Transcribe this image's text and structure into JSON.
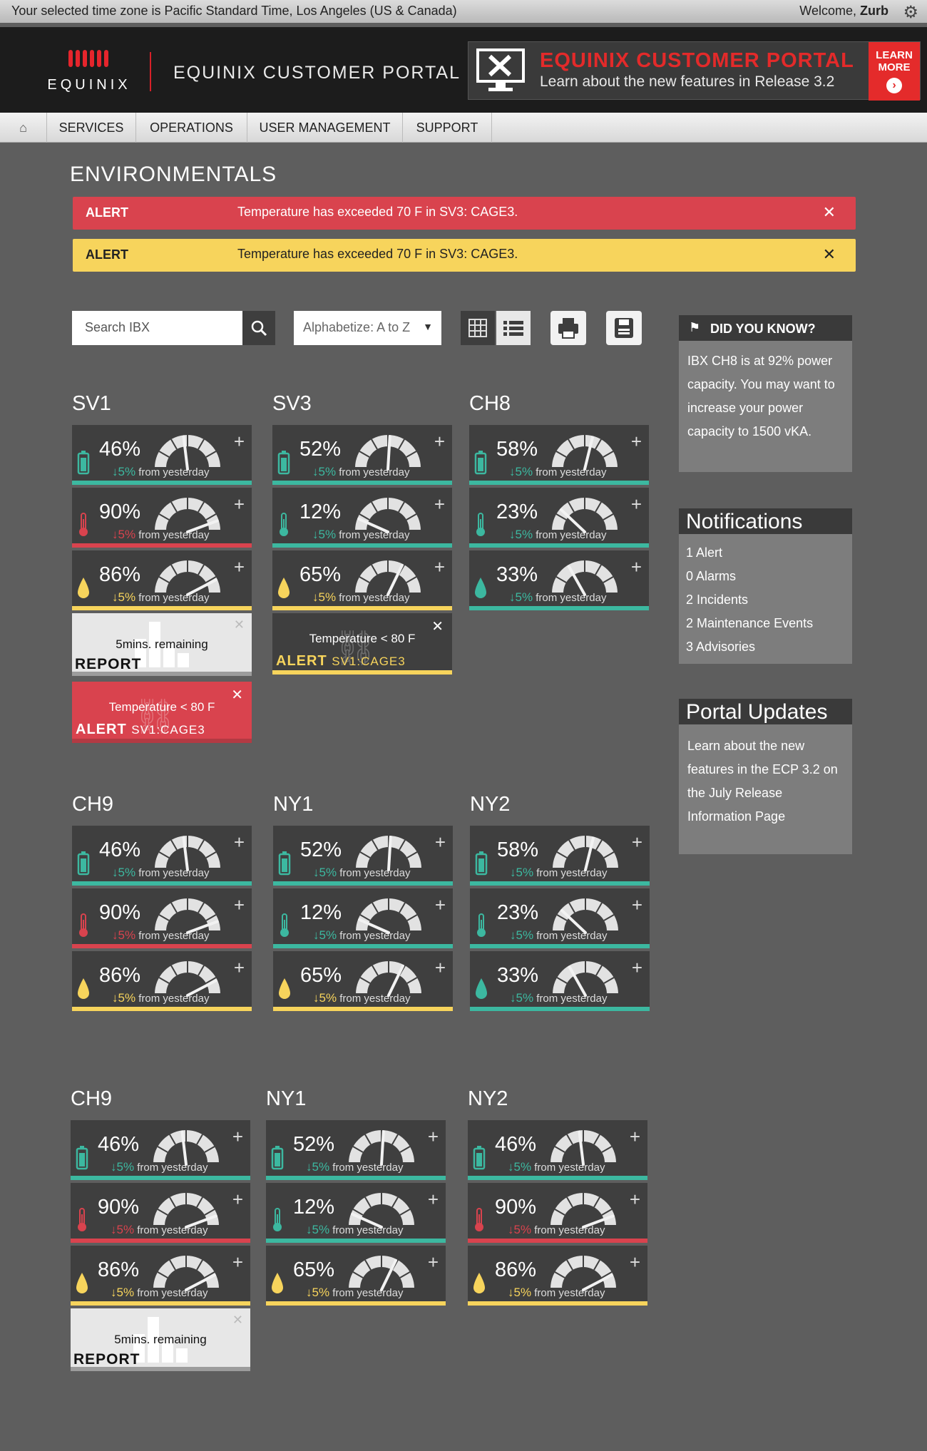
{
  "topbar": {
    "timezone": "Your selected time zone is Pacific Standard Time, Los Angeles (US & Canada)",
    "welcome_prefix": "Welcome,",
    "user": "Zurb",
    "settings_icon": "gear-icon"
  },
  "header": {
    "logo_text": "EQUINIX",
    "title": "EQUINIX CUSTOMER PORTAL",
    "promo_title": "EQUINIX CUSTOMER PORTAL",
    "promo_subtitle": "Learn about the new features in Release 3.2",
    "learn_line1": "LEARN",
    "learn_line2": "MORE",
    "brand_red": "#e42b2b"
  },
  "nav": {
    "home_icon": "home-icon",
    "items": [
      "SERVICES",
      "OPERATIONS",
      "USER MANAGEMENT",
      "SUPPORT"
    ]
  },
  "page": {
    "title": "ENVIRONMENTALS"
  },
  "alerts": [
    {
      "label": "ALERT",
      "message": "Temperature has exceeded 70 F in SV3: CAGE3.",
      "color": "#d9434e"
    },
    {
      "label": "ALERT",
      "message": "Temperature has exceeded 70 F in SV3: CAGE3.",
      "color": "#f7d45c"
    }
  ],
  "toolbar": {
    "search_placeholder": "Search IBX",
    "sort_value": "Alphabetize: A to Z",
    "icons": [
      "search-icon",
      "grid-view-icon",
      "list-view-icon",
      "print-icon",
      "save-icon"
    ]
  },
  "sidebar": {
    "did_you_know": {
      "title": "DID YOU KNOW?",
      "body": "IBX CH8 is at 92% power capacity. You may want to increase your power capacity to 1500 vKA."
    },
    "notifications": {
      "title": "Notifications",
      "items": [
        "1 Alert",
        "0 Alarms",
        "2 Incidents",
        "2 Maintenance Events",
        "3 Advisories"
      ]
    },
    "portal_updates": {
      "title": "Portal Updates",
      "body": "Learn about the new features in the ECP 3.2 on the July Release Information Page"
    }
  },
  "colors": {
    "teal": "#3cb8a0",
    "red": "#d9434e",
    "yellow": "#f7d45c"
  },
  "sites": {
    "sv1": {
      "name": "SV1",
      "metrics": [
        {
          "type": "power",
          "pct": "46%",
          "delta": "5%",
          "from": "from yesterday",
          "status": "teal",
          "level": 0.46
        },
        {
          "type": "temperature",
          "pct": "90%",
          "delta": "5%",
          "from": "from yesterday",
          "status": "red",
          "level": 0.9
        },
        {
          "type": "humidity",
          "pct": "86%",
          "delta": "5%",
          "from": "from yesterday",
          "status": "yellow",
          "level": 0.86
        }
      ],
      "report": {
        "remaining": "5mins. remaining",
        "label": "REPORT"
      },
      "cage_alert": {
        "temp": "Temperature < 80 F",
        "label": "ALERT",
        "location": "SV1:CAGE3",
        "color": "red"
      }
    },
    "sv3": {
      "name": "SV3",
      "metrics": [
        {
          "type": "power",
          "pct": "52%",
          "delta": "5%",
          "from": "from yesterday",
          "status": "teal",
          "level": 0.52
        },
        {
          "type": "temperature",
          "pct": "12%",
          "delta": "5%",
          "from": "from yesterday",
          "status": "teal",
          "level": 0.12
        },
        {
          "type": "humidity",
          "pct": "65%",
          "delta": "5%",
          "from": "from yesterday",
          "status": "yellow",
          "level": 0.65
        }
      ],
      "cage_alert": {
        "temp": "Temperature < 80 F",
        "label": "ALERT",
        "location": "SV1:CAGE3",
        "color": "dark"
      }
    },
    "ch8": {
      "name": "CH8",
      "metrics": [
        {
          "type": "power",
          "pct": "58%",
          "delta": "5%",
          "from": "from yesterday",
          "status": "teal",
          "level": 0.58
        },
        {
          "type": "temperature",
          "pct": "23%",
          "delta": "5%",
          "from": "from yesterday",
          "status": "teal",
          "level": 0.23
        },
        {
          "type": "humidity",
          "pct": "33%",
          "delta": "5%",
          "from": "from yesterday",
          "status": "teal",
          "level": 0.33
        }
      ]
    },
    "ch9a": {
      "name": "CH9",
      "metrics": [
        {
          "type": "power",
          "pct": "46%",
          "delta": "5%",
          "from": "from yesterday",
          "status": "teal",
          "level": 0.46
        },
        {
          "type": "temperature",
          "pct": "90%",
          "delta": "5%",
          "from": "from yesterday",
          "status": "red",
          "level": 0.9
        },
        {
          "type": "humidity",
          "pct": "86%",
          "delta": "5%",
          "from": "from yesterday",
          "status": "yellow",
          "level": 0.86
        }
      ]
    },
    "ny1a": {
      "name": "NY1",
      "metrics": [
        {
          "type": "power",
          "pct": "52%",
          "delta": "5%",
          "from": "from yesterday",
          "status": "teal",
          "level": 0.52
        },
        {
          "type": "temperature",
          "pct": "12%",
          "delta": "5%",
          "from": "from yesterday",
          "status": "teal",
          "level": 0.12
        },
        {
          "type": "humidity",
          "pct": "65%",
          "delta": "5%",
          "from": "from yesterday",
          "status": "yellow",
          "level": 0.65
        }
      ]
    },
    "ny2a": {
      "name": "NY2",
      "metrics": [
        {
          "type": "power",
          "pct": "58%",
          "delta": "5%",
          "from": "from yesterday",
          "status": "teal",
          "level": 0.58
        },
        {
          "type": "temperature",
          "pct": "23%",
          "delta": "5%",
          "from": "from yesterday",
          "status": "teal",
          "level": 0.23
        },
        {
          "type": "humidity",
          "pct": "33%",
          "delta": "5%",
          "from": "from yesterday",
          "status": "teal",
          "level": 0.33
        }
      ]
    },
    "ch9b": {
      "name": "CH9",
      "metrics": [
        {
          "type": "power",
          "pct": "46%",
          "delta": "5%",
          "from": "from yesterday",
          "status": "teal",
          "level": 0.46
        },
        {
          "type": "temperature",
          "pct": "90%",
          "delta": "5%",
          "from": "from yesterday",
          "status": "red",
          "level": 0.9
        },
        {
          "type": "humidity",
          "pct": "86%",
          "delta": "5%",
          "from": "from yesterday",
          "status": "yellow",
          "level": 0.86
        }
      ],
      "report": {
        "remaining": "5mins. remaining",
        "label": "REPORT"
      }
    },
    "ny1b": {
      "name": "NY1",
      "metrics": [
        {
          "type": "power",
          "pct": "52%",
          "delta": "5%",
          "from": "from yesterday",
          "status": "teal",
          "level": 0.52
        },
        {
          "type": "temperature",
          "pct": "12%",
          "delta": "5%",
          "from": "from yesterday",
          "status": "teal",
          "level": 0.12
        },
        {
          "type": "humidity",
          "pct": "65%",
          "delta": "5%",
          "from": "from yesterday",
          "status": "yellow",
          "level": 0.65
        }
      ]
    },
    "ny2b": {
      "name": "NY2",
      "metrics": [
        {
          "type": "power",
          "pct": "46%",
          "delta": "5%",
          "from": "from yesterday",
          "status": "teal",
          "level": 0.46
        },
        {
          "type": "temperature",
          "pct": "90%",
          "delta": "5%",
          "from": "from yesterday",
          "status": "red",
          "level": 0.9
        },
        {
          "type": "humidity",
          "pct": "86%",
          "delta": "5%",
          "from": "from yesterday",
          "status": "yellow",
          "level": 0.86
        }
      ]
    }
  }
}
